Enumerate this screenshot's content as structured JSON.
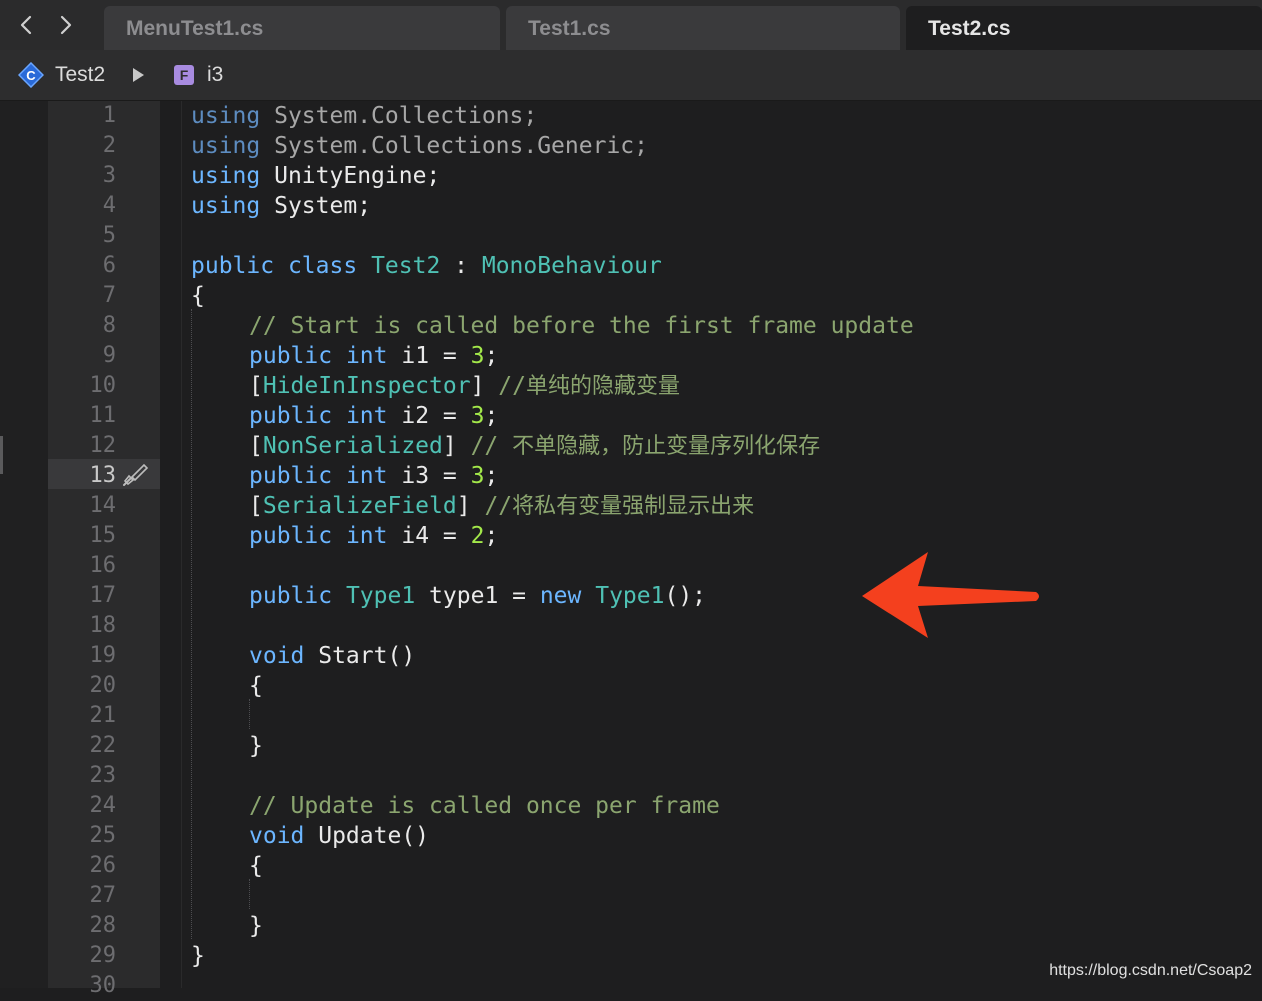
{
  "tabs": [
    {
      "label": "MenuTest1.cs",
      "active": false
    },
    {
      "label": "Test1.cs",
      "active": false
    },
    {
      "label": "Test2.cs",
      "active": true
    }
  ],
  "breadcrumb": {
    "class_icon_letter": "C",
    "class_name": "Test2",
    "field_icon_letter": "F",
    "field_name": "i3"
  },
  "editor": {
    "current_line": 13,
    "line_numbers": [
      "1",
      "2",
      "3",
      "4",
      "5",
      "6",
      "7",
      "8",
      "9",
      "10",
      "11",
      "12",
      "13",
      "14",
      "15",
      "16",
      "17",
      "18",
      "19",
      "20",
      "21",
      "22",
      "23",
      "24",
      "25",
      "26",
      "27",
      "28",
      "29",
      "30"
    ]
  },
  "code": {
    "using": "using",
    "ns_collections": "System.Collections;",
    "ns_generic": "System.Collections.Generic;",
    "ns_unity": "UnityEngine;",
    "ns_system": "System;",
    "public": "public",
    "class": "class",
    "class_name": "Test2",
    "colon": " : ",
    "base_class": "MonoBehaviour",
    "open_brace": "{",
    "close_brace": "}",
    "comment_start": "// Start is called before the first frame update",
    "int": "int",
    "i1_decl": " i1 = ",
    "i2_decl": " i2 = ",
    "i3_decl": " i3 = ",
    "i4_decl": " i4 = ",
    "three": "3",
    "two": "2",
    "semicolon": ";",
    "lbracket": "[",
    "rbracket": "]",
    "hide_attr": "HideInInspector",
    "hide_comment_slashes": " //",
    "hide_comment_text": "单纯的隐藏变量",
    "nonser_attr": "NonSerialized",
    "nonser_comment_slashes": " // ",
    "nonser_comment_text": "不单隐藏，防止变量序列化保存",
    "serfield_attr": "SerializeField",
    "serfield_comment_slashes": " //",
    "serfield_comment_text": "将私有变量强制显示出来",
    "type1": "Type1",
    "type1_var": " type1 = ",
    "new": "new",
    "parens_semicolon": "();",
    "void": "void",
    "start_method": " Start()",
    "comment_update": "// Update is called once per frame",
    "update_method": " Update()"
  },
  "watermark": "https://blog.csdn.net/Csoap2",
  "colors": {
    "accent_arrow": "#f4401e",
    "keyword": "#6cb6ff",
    "type": "#4fc1b4",
    "number": "#a3e84a",
    "comment": "#8ba56f"
  }
}
